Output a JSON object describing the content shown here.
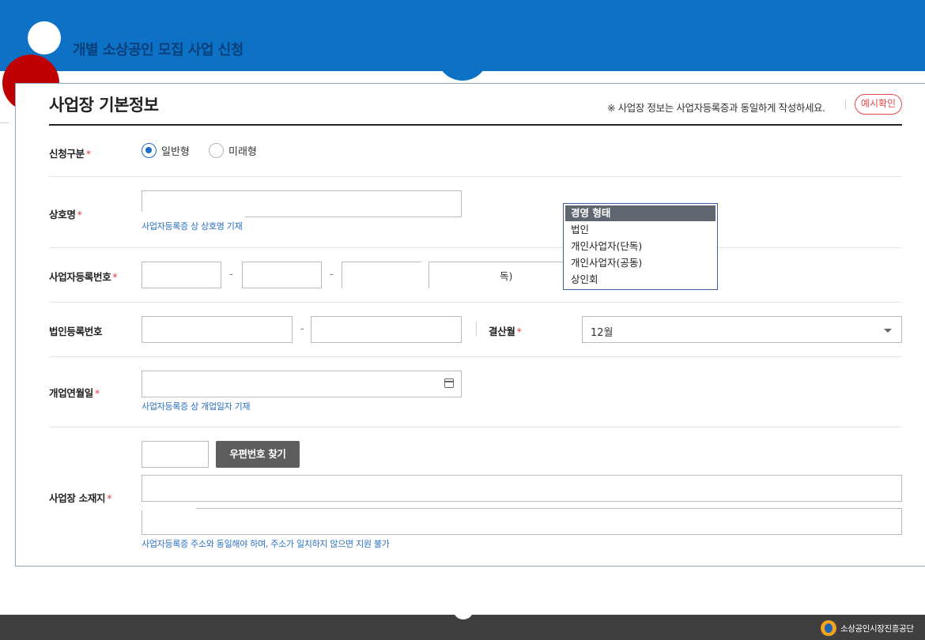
{
  "header": {
    "title": "개별 소상공인 모집 사업 신청"
  },
  "section": {
    "title": "사업장 기본정보",
    "notice": "※ 사업장 정보는 사업자등록증과 동일하게 작성하세요.",
    "example_button": "예시확인"
  },
  "fields": {
    "application_type": {
      "label": "신청구분",
      "options": [
        {
          "label": "일반형",
          "selected": true
        },
        {
          "label": "미래형",
          "selected": false
        }
      ]
    },
    "business_name": {
      "label": "상호명",
      "value": "",
      "helper": "사업자등록증 상 상호명 기재"
    },
    "business_reg_number": {
      "label": "사업자등록번호",
      "separator": "-",
      "trailing_text": "독)"
    },
    "corporate_reg_number": {
      "label": "법인등록번호",
      "separator": "-"
    },
    "settlement_month": {
      "label": "결산월",
      "value": "12월"
    },
    "opening_date": {
      "label": "개업연월일",
      "helper": "사업자등록증 상 개업일자 기재"
    },
    "address": {
      "label": "사업장 소재지",
      "zip_button": "우편번호 찾기",
      "helper": "사업자등록증 주소와 동일해야 하며, 주소가 일치하지 않으면 지원 불가"
    }
  },
  "required_mark": "*",
  "business_type_dropdown": {
    "header": "경영 형태",
    "options": [
      "법인",
      "개인사업자(단독)",
      "개인사업자(공동)",
      "상인회"
    ]
  },
  "footer": {
    "org_name": "소상공인시장진흥공단"
  },
  "colors": {
    "banner": "#0d72c5",
    "accent_red": "#c00000",
    "helper_blue": "#2a6fc0",
    "required_red": "#e23b3b"
  }
}
